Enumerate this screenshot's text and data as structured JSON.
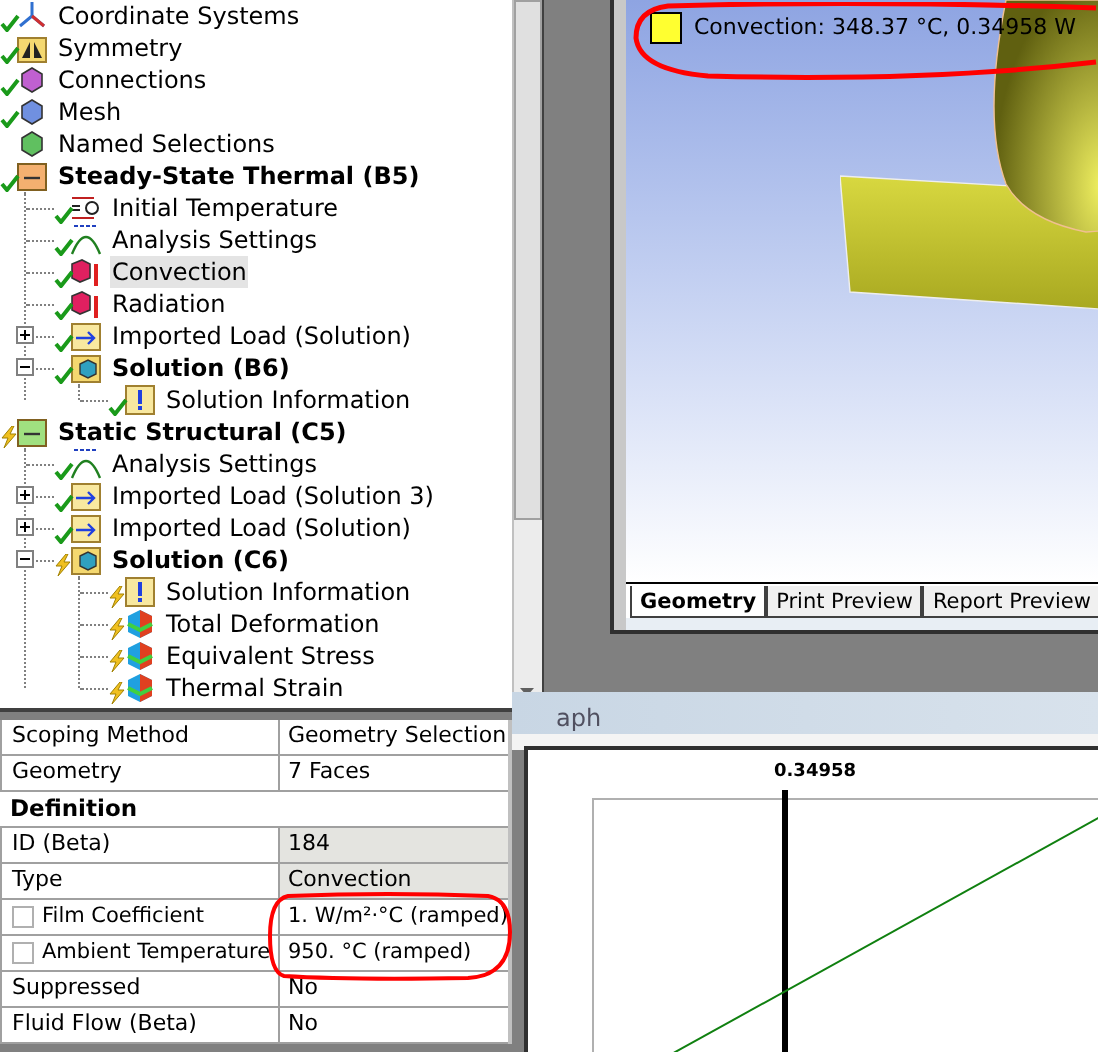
{
  "tree": [
    {
      "label": "Coordinate Systems",
      "kind": "axes",
      "solved": true,
      "selected": false,
      "bold": false
    },
    {
      "label": "Symmetry",
      "kind": "symmetry",
      "solved": true,
      "selected": false,
      "bold": false
    },
    {
      "label": "Connections",
      "kind": "connections",
      "solved": true,
      "selected": false,
      "bold": false
    },
    {
      "label": "Mesh",
      "kind": "mesh",
      "solved": true,
      "selected": false,
      "bold": false
    },
    {
      "label": "Named Selections",
      "kind": "named",
      "selected": false,
      "bold": false
    },
    {
      "label": "Steady-State Thermal (B5)",
      "kind": "thermal",
      "solved": true,
      "selected": false,
      "bold": true,
      "children": [
        {
          "label": "Initial Temperature",
          "kind": "initial",
          "solved": true,
          "selected": false,
          "bold": false
        },
        {
          "label": "Analysis Settings",
          "kind": "settings",
          "solved": true,
          "selected": false,
          "bold": false
        },
        {
          "label": "Convection",
          "kind": "load",
          "solved": true,
          "selected": true,
          "bold": false
        },
        {
          "label": "Radiation",
          "kind": "load",
          "solved": true,
          "selected": false,
          "bold": false
        },
        {
          "label": "Imported Load (Solution)",
          "kind": "imported",
          "solved": true,
          "selected": false,
          "bold": false,
          "expanded": false
        },
        {
          "label": "Solution (B6)",
          "kind": "solution",
          "solved": true,
          "selected": false,
          "bold": true,
          "expanded": true,
          "children": [
            {
              "label": "Solution Information",
              "kind": "info",
              "solved": true,
              "selected": false,
              "bold": false
            }
          ]
        }
      ]
    },
    {
      "label": "Static Structural (C5)",
      "kind": "structural",
      "solved": false,
      "selected": false,
      "bold": true,
      "children": [
        {
          "label": "Analysis Settings",
          "kind": "settings",
          "solved": true,
          "selected": false,
          "bold": false
        },
        {
          "label": "Imported Load (Solution 3)",
          "kind": "imported",
          "solved": true,
          "selected": false,
          "bold": false,
          "expanded": false
        },
        {
          "label": "Imported Load (Solution)",
          "kind": "imported",
          "solved": true,
          "selected": false,
          "bold": false,
          "expanded": false
        },
        {
          "label": "Solution (C6)",
          "kind": "solution",
          "solved": false,
          "selected": false,
          "bold": true,
          "expanded": true,
          "children": [
            {
              "label": "Solution Information",
              "kind": "info",
              "solved": false,
              "selected": false,
              "bold": false
            },
            {
              "label": "Total Deformation",
              "kind": "result",
              "solved": false,
              "selected": false,
              "bold": false
            },
            {
              "label": "Equivalent Stress",
              "kind": "result",
              "solved": false,
              "selected": false,
              "bold": false
            },
            {
              "label": "Thermal Strain",
              "kind": "result",
              "solved": false,
              "selected": false,
              "bold": false
            }
          ]
        }
      ]
    }
  ],
  "viewport": {
    "legend": "Convection: 348.37 °C, 0.34958 W",
    "tabs": [
      {
        "label": "Geometry",
        "selected": true
      },
      {
        "label": "Print Preview",
        "selected": false
      },
      {
        "label": "Report Preview",
        "selected": false
      }
    ]
  },
  "graph": {
    "title": "aph",
    "cursor_label": "0.34958"
  },
  "details": [
    {
      "kind": "property",
      "label": "Scoping Method",
      "value": "Geometry Selection",
      "readonly": false
    },
    {
      "kind": "property",
      "label": "Geometry",
      "value": "7 Faces",
      "readonly": false
    },
    {
      "kind": "section",
      "label": "Definition"
    },
    {
      "kind": "property",
      "label": "ID (Beta)",
      "value": "184",
      "readonly": true
    },
    {
      "kind": "property",
      "label": "Type",
      "value": "Convection",
      "readonly": true
    },
    {
      "kind": "parameter",
      "label": "Film Coefficient",
      "value": "1. W/m²·°C  (ramped)",
      "checked": false
    },
    {
      "kind": "parameter",
      "label": "Ambient Temperature",
      "value": "950. °C  (ramped)",
      "checked": false
    },
    {
      "kind": "property",
      "label": "Suppressed",
      "value": "No",
      "readonly": false
    },
    {
      "kind": "property",
      "label": "Fluid Flow (Beta)",
      "value": "No",
      "readonly": false
    }
  ]
}
